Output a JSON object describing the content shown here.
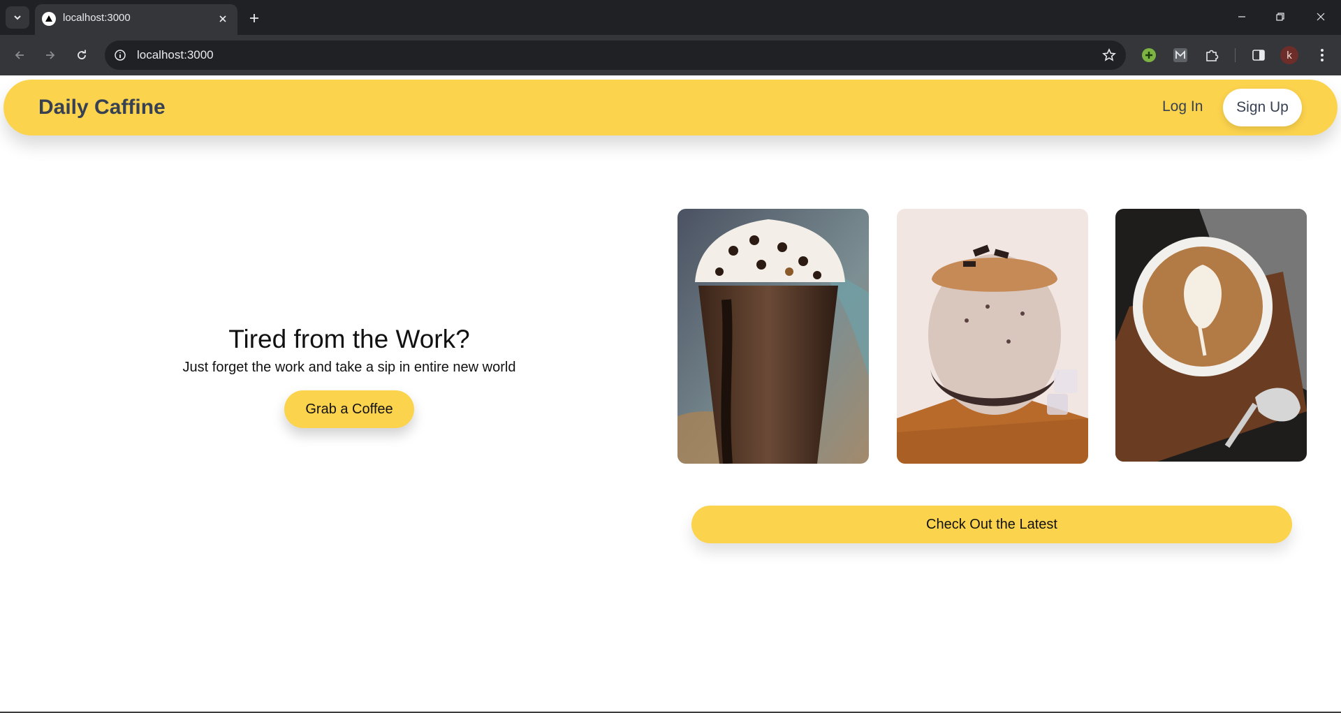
{
  "browser": {
    "tab_title": "localhost:3000",
    "url": "localhost:3000",
    "profile_initial": "k",
    "extensions": [
      "add-extension-icon",
      "m-extension-icon",
      "puzzle-icon"
    ]
  },
  "navbar": {
    "brand": "Daily Caffine",
    "login_label": "Log In",
    "signup_label": "Sign Up"
  },
  "hero": {
    "title": "Tired from the Work?",
    "subtitle": "Just forget the work and take a sip in entire new world",
    "cta_label": "Grab a Coffee"
  },
  "gallery": {
    "images": [
      "chocolate-frappe-image",
      "cookies-cream-shake-image",
      "latte-art-image"
    ],
    "cta_label": "Check Out the Latest"
  },
  "colors": {
    "accent": "#fcd34d",
    "text_dark": "#374151",
    "chrome_dark": "#202124",
    "chrome_mid": "#35363a"
  }
}
